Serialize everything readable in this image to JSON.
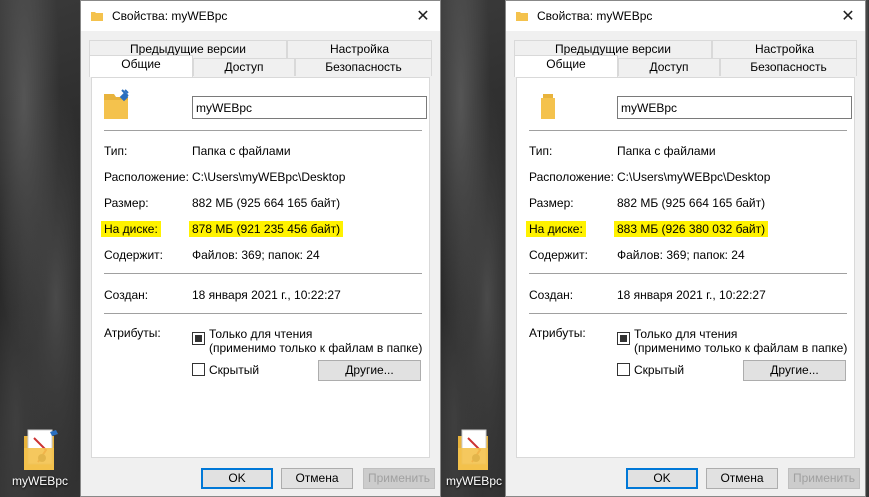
{
  "desktop": {
    "icon_label": "myWEBpc"
  },
  "dialogs": [
    {
      "title": "Свойства: myWEBpc",
      "tabs": {
        "prev": "Предыдущие версии",
        "custom": "Настройка",
        "general": "Общие",
        "access": "Доступ",
        "security": "Безопасность"
      },
      "name_value": "myWEBpc",
      "rows": {
        "type_label": "Тип:",
        "type_value": "Папка с файлами",
        "location_label": "Расположение:",
        "location_value": "C:\\Users\\myWEBpc\\Desktop",
        "size_label": "Размер:",
        "size_value": "882 МБ (925 664 165 байт)",
        "ondisk_label": "На диске:",
        "ondisk_value": "878 МБ (921 235 456 байт)",
        "contains_label": "Содержит:",
        "contains_value": "Файлов: 369; папок: 24",
        "created_label": "Создан:",
        "created_value": "18 января 2021 г., 10:22:27",
        "attributes_label": "Атрибуты:",
        "readonly_label": "Только для чтения",
        "readonly_sub": "(применимо только к файлам в папке)",
        "hidden_label": "Скрытый",
        "other_button": "Другие..."
      },
      "buttons": {
        "ok": "OK",
        "cancel": "Отмена",
        "apply": "Применить"
      }
    },
    {
      "title": "Свойства: myWEBpc",
      "tabs": {
        "prev": "Предыдущие версии",
        "custom": "Настройка",
        "general": "Общие",
        "access": "Доступ",
        "security": "Безопасность"
      },
      "name_value": "myWEBpc",
      "rows": {
        "type_label": "Тип:",
        "type_value": "Папка с файлами",
        "location_label": "Расположение:",
        "location_value": "C:\\Users\\myWEBpc\\Desktop",
        "size_label": "Размер:",
        "size_value": "882 МБ (925 664 165 байт)",
        "ondisk_label": "На диске:",
        "ondisk_value": "883 МБ (926 380 032 байт)",
        "contains_label": "Содержит:",
        "contains_value": "Файлов: 369; папок: 24",
        "created_label": "Создан:",
        "created_value": "18 января 2021 г., 10:22:27",
        "attributes_label": "Атрибуты:",
        "readonly_label": "Только для чтения",
        "readonly_sub": "(применимо только к файлам в папке)",
        "hidden_label": "Скрытый",
        "other_button": "Другие..."
      },
      "buttons": {
        "ok": "OK",
        "cancel": "Отмена",
        "apply": "Применить"
      }
    }
  ],
  "colors": {
    "highlight": "#fff200",
    "accent": "#0078d7",
    "folder": "#f4c24d"
  },
  "icons": [
    "folder-icon",
    "folder-compressed-icon",
    "close-icon"
  ]
}
